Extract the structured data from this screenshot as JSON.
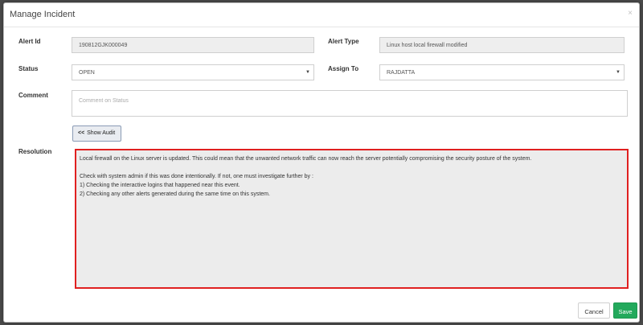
{
  "dialog": {
    "title": "Manage Incident",
    "close_glyph": "×"
  },
  "form": {
    "alert_id_label": "Alert Id",
    "alert_id_value": "190812GJK000049",
    "alert_type_label": "Alert Type",
    "alert_type_value": "Linux host local firewall modified",
    "status_label": "Status",
    "status_value": "OPEN",
    "assign_to_label": "Assign To",
    "assign_to_value": "RAJDATTA",
    "comment_label": "Comment",
    "comment_placeholder": "Comment on Status",
    "show_audit_icon": "<<",
    "show_audit_label": "Show Audit",
    "resolution_label": "Resolution",
    "resolution_lines": [
      "Local firewall on the Linux server is updated. This could mean that the unwanted network traffic can now reach the server potentially compromising the security posture of the system.",
      "Check with system admin if this was done intentionally. If not, one must investigate further by :",
      "1) Checking the interactive logins that happened near this event.",
      "2) Checking any other alerts generated during the same time on this system."
    ]
  },
  "footer": {
    "cancel_label": "Cancel",
    "save_label": "Save"
  },
  "colors": {
    "save_green": "#23a95c",
    "resolution_border": "#e02020"
  }
}
